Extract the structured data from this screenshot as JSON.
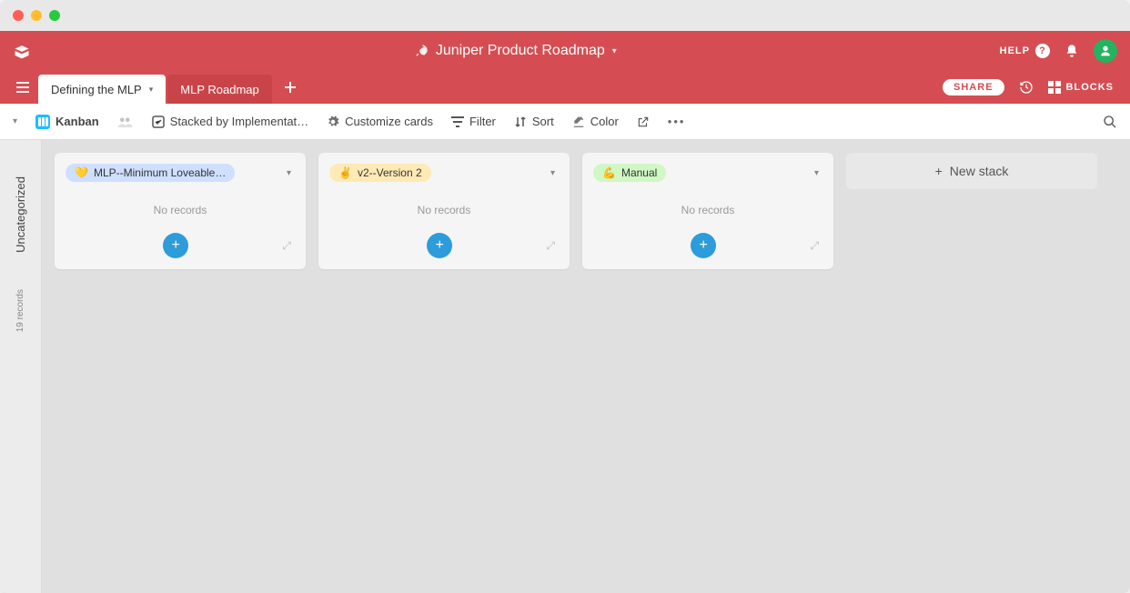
{
  "header": {
    "title": "Juniper Product Roadmap",
    "help_label": "HELP"
  },
  "tabs": {
    "active": "Defining the MLP",
    "inactive": "MLP Roadmap",
    "share_label": "SHARE",
    "blocks_label": "BLOCKS"
  },
  "toolbar": {
    "view_name": "Kanban",
    "stacked_label": "Stacked by Implementat…",
    "customize_label": "Customize cards",
    "filter_label": "Filter",
    "sort_label": "Sort",
    "color_label": "Color"
  },
  "sidebar": {
    "group_label": "Uncategorized",
    "count_label": "19 records"
  },
  "stacks": [
    {
      "emoji": "💛",
      "label": "MLP--Minimum Loveable…",
      "pill_class": "blue",
      "empty_text": "No records"
    },
    {
      "emoji": "✌️",
      "label": "v2--Version 2",
      "pill_class": "yellow",
      "empty_text": "No records"
    },
    {
      "emoji": "💪",
      "label": "Manual",
      "pill_class": "green",
      "empty_text": "No records"
    }
  ],
  "new_stack_label": "New stack"
}
